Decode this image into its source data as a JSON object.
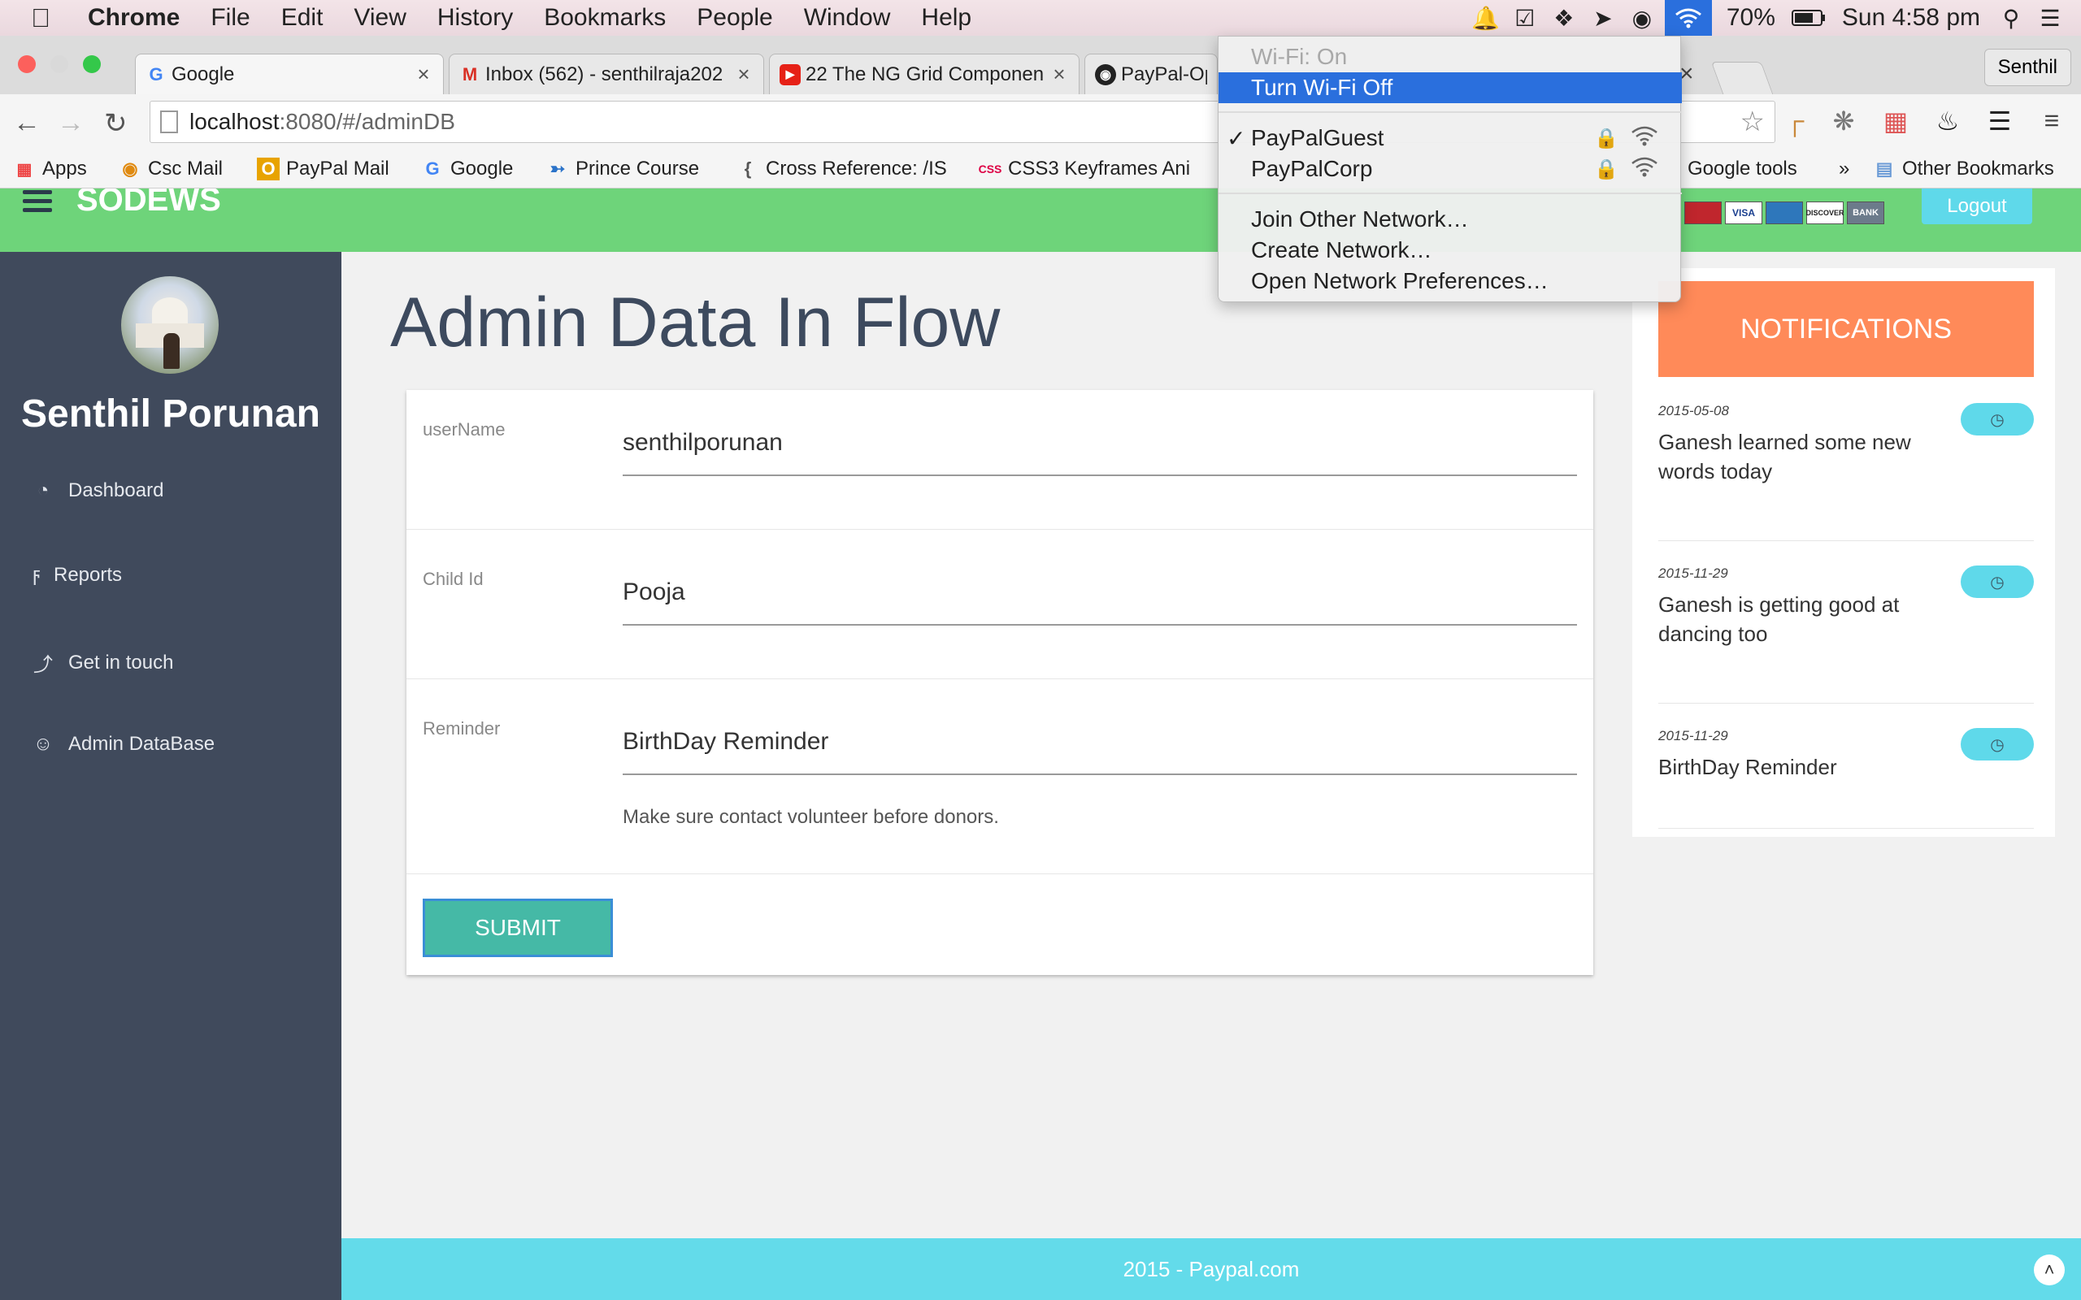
{
  "menubar": {
    "app": "Chrome",
    "items": [
      "File",
      "Edit",
      "View",
      "History",
      "Bookmarks",
      "People",
      "Window",
      "Help"
    ],
    "battery": "70%",
    "clock": "Sun 4:58 pm"
  },
  "tabs": [
    {
      "title": "Google",
      "icon": "google-icon"
    },
    {
      "title": "Inbox (562) - senthilraja202",
      "icon": "gmail-icon"
    },
    {
      "title": "22 The NG Grid Componen",
      "icon": "youtube-icon"
    },
    {
      "title": "PayPal-Op",
      "icon": "github-icon"
    }
  ],
  "profile_name": "Senthil",
  "address": {
    "host": "localhost",
    "path": ":8080/#/adminDB"
  },
  "bookmarks": [
    {
      "label": "Apps"
    },
    {
      "label": "Csc Mail"
    },
    {
      "label": "PayPal Mail"
    },
    {
      "label": "Google"
    },
    {
      "label": "Prince Course"
    },
    {
      "label": "Cross Reference: /IS"
    },
    {
      "label": "CSS3 Keyframes Ani"
    },
    {
      "label": "Google tools"
    },
    {
      "label": "»"
    },
    {
      "label": "Other Bookmarks"
    }
  ],
  "wifi_menu": {
    "status": "Wi-Fi: On",
    "toggle": "Turn Wi-Fi Off",
    "networks": [
      {
        "name": "PayPalGuest",
        "checked": "✓"
      },
      {
        "name": "PayPalCorp",
        "checked": ""
      }
    ],
    "actions": [
      "Join Other Network…",
      "Create Network…",
      "Open Network Preferences…"
    ]
  },
  "app": {
    "brand": "SODEWS",
    "logout": "Logout",
    "cards": [
      "",
      "VISA",
      "",
      "DISCOVER",
      "BANK"
    ]
  },
  "sidebar": {
    "user": "Senthil Porunan",
    "items": [
      {
        "label": "Dashboard",
        "icon": "dashboard-icon"
      },
      {
        "label": "Reports",
        "icon": "bolt-icon"
      },
      {
        "label": "Get in touch",
        "icon": "share-icon"
      },
      {
        "label": "Admin DataBase",
        "icon": "user-icon"
      }
    ]
  },
  "main": {
    "title": "Admin Data In Flow",
    "fields": [
      {
        "label": "userName",
        "value": "senthilporunan"
      },
      {
        "label": "Child Id",
        "value": "Pooja"
      },
      {
        "label": "Reminder",
        "value": "BirthDay Reminder",
        "hint": "Make sure contact volunteer before donors."
      }
    ],
    "submit": "SUBMIT"
  },
  "notifications": {
    "title": "NOTIFICATIONS",
    "items": [
      {
        "date": "2015-05-08",
        "text": "Ganesh learned some new words today"
      },
      {
        "date": "2015-11-29",
        "text": "Ganesh is getting good at dancing too"
      },
      {
        "date": "2015-11-29",
        "text": "BirthDay Reminder"
      }
    ]
  },
  "footer": {
    "text": "2015 - Paypal.com"
  },
  "colors": {
    "header": "#6ed47a",
    "sidebar": "#404a5c",
    "notif_head": "#ff8a59",
    "footer": "#63dbea",
    "submit": "#45b9a6"
  }
}
